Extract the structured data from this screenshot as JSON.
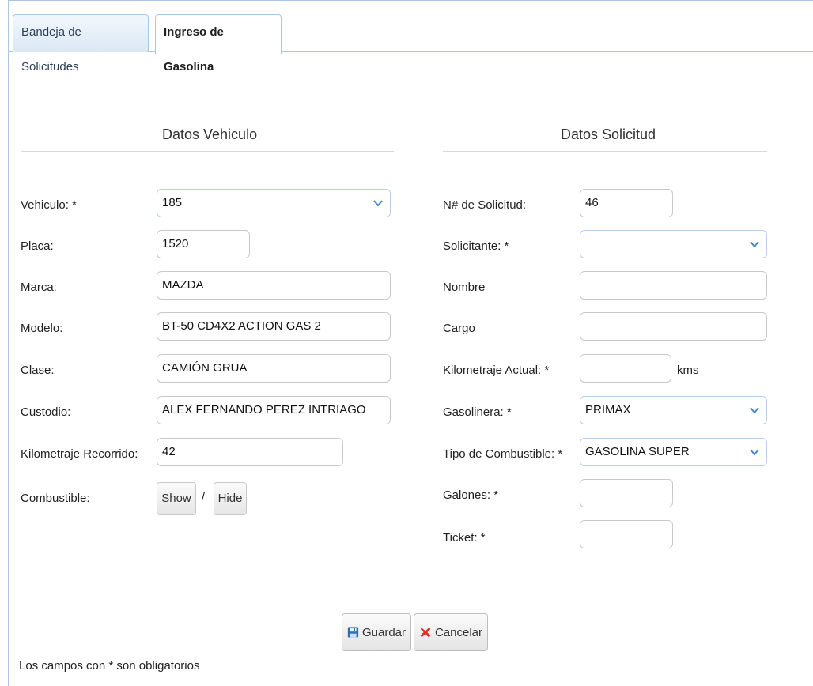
{
  "tabs": [
    {
      "label": "Bandeja de Solicitudes"
    },
    {
      "label": "Ingreso de Gasolina"
    }
  ],
  "vehiculo_section": {
    "title": "Datos Vehiculo",
    "vehiculo_label": "Vehiculo: *",
    "vehiculo_value": "185",
    "placa_label": "Placa:",
    "placa_value": "1520",
    "marca_label": "Marca:",
    "marca_value": "MAZDA",
    "modelo_label": "Modelo:",
    "modelo_value": "BT-50 CD4X2 ACTION GAS 2",
    "clase_label": "Clase:",
    "clase_value": "CAMIÓN GRUA",
    "custodio_label": "Custodio:",
    "custodio_value": "ALEX FERNANDO PEREZ INTRIAGO",
    "km_recorrido_label": "Kilometraje Recorrido:",
    "km_recorrido_value": "42",
    "combustible_label": "Combustible:",
    "show_label": "Show",
    "separator": "/",
    "hide_label": "Hide"
  },
  "solicitud_section": {
    "title": "Datos Solicitud",
    "numero_label": "N# de Solicitud:",
    "numero_value": "46",
    "solicitante_label": "Solicitante: *",
    "solicitante_value": "",
    "nombre_label": "Nombre",
    "nombre_value": "",
    "cargo_label": "Cargo",
    "cargo_value": "",
    "km_actual_label": "Kilometraje Actual: *",
    "km_actual_value": "",
    "km_unit": "kms",
    "gasolinera_label": "Gasolinera: *",
    "gasolinera_value": "PRIMAX",
    "tipo_label": "Tipo de Combustible: *",
    "tipo_value": "GASOLINA SUPER",
    "galones_label": "Galones: *",
    "galones_value": "",
    "ticket_label": "Ticket: *",
    "ticket_value": ""
  },
  "actions": {
    "save_label": "Guardar",
    "cancel_label": "Cancelar"
  },
  "footnote": "Los campos con * son obligatorios",
  "colors": {
    "border": "#aac8e4",
    "chevron": "#4a86c8",
    "cancel_icon": "#d9342b",
    "save_icon": "#2f6db5"
  }
}
